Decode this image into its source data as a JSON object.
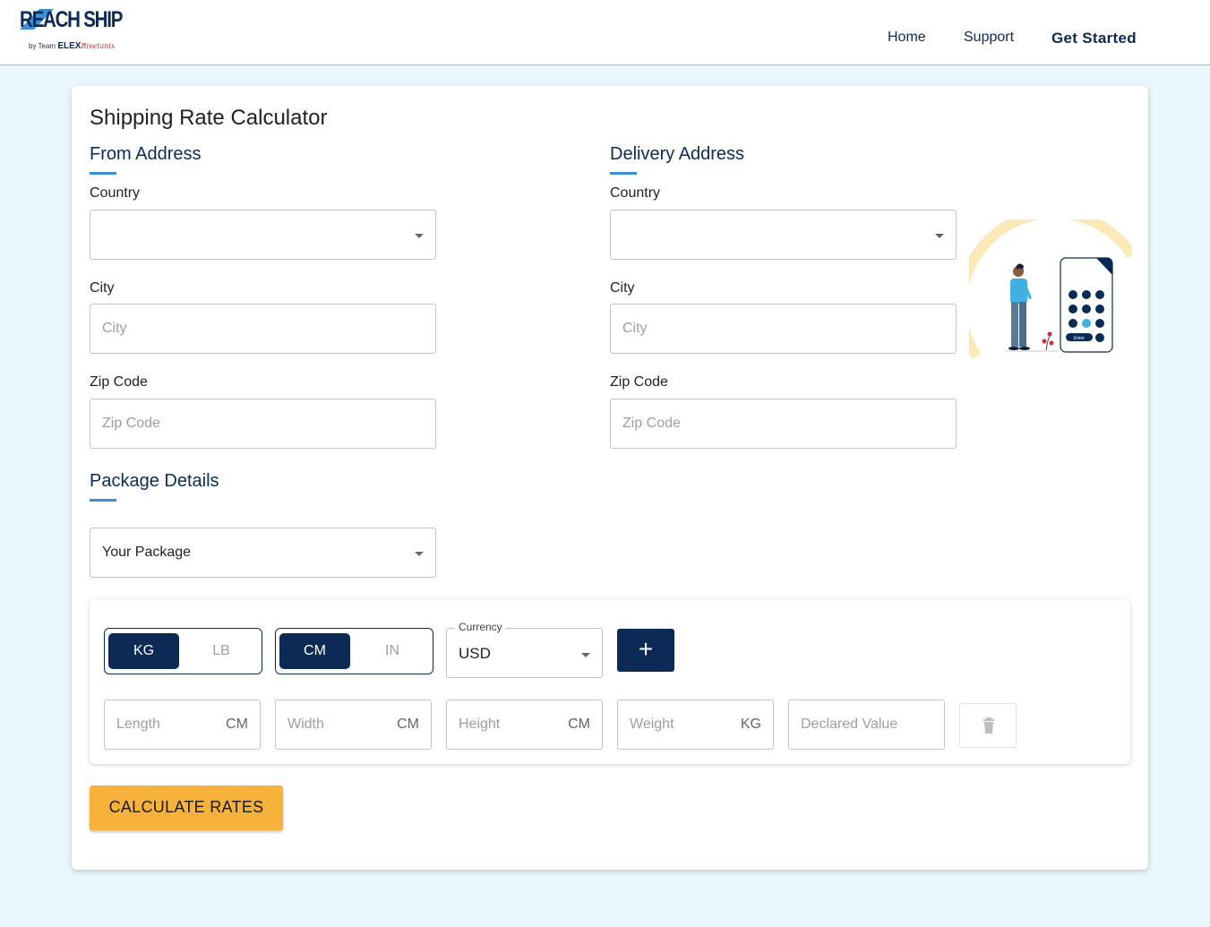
{
  "header": {
    "logo_main": "REACH SHIP",
    "logo_by": "by Team",
    "logo_brand": "ELEX",
    "logo_script": "Rivetanix",
    "nav": {
      "home": "Home",
      "support": "Support",
      "get_started": "Get Started"
    }
  },
  "main": {
    "title": "Shipping Rate Calculator",
    "from": {
      "heading": "From Address",
      "country_label": "Country",
      "country_value": "",
      "city_label": "City",
      "city_placeholder": "City",
      "zip_label": "Zip Code",
      "zip_placeholder": "Zip Code"
    },
    "delivery": {
      "heading": "Delivery Address",
      "country_label": "Country",
      "country_value": "",
      "city_label": "City",
      "city_placeholder": "City",
      "zip_label": "Zip Code",
      "zip_placeholder": "Zip Code"
    },
    "package": {
      "heading": "Package Details",
      "select_value": "Your Package",
      "weight_units": [
        "KG",
        "LB"
      ],
      "weight_selected": "KG",
      "dim_units": [
        "CM",
        "IN"
      ],
      "dim_selected": "CM",
      "currency_label": "Currency",
      "currency_value": "USD",
      "add_label": "+",
      "fields": [
        {
          "placeholder": "Length",
          "unit": "CM"
        },
        {
          "placeholder": "Width",
          "unit": "CM"
        },
        {
          "placeholder": "Height",
          "unit": "CM"
        },
        {
          "placeholder": "Weight",
          "unit": "KG"
        },
        {
          "placeholder": "Declared Value",
          "unit": ""
        }
      ]
    },
    "calculate_label": "CALCULATE RATES",
    "illustration": {
      "keypad_enter": "Enter"
    }
  },
  "colors": {
    "navy": "#0b2a55",
    "accent_blue": "#3b8fd6",
    "button_yellow": "#f7b23b",
    "background": "#e9f6fd"
  }
}
